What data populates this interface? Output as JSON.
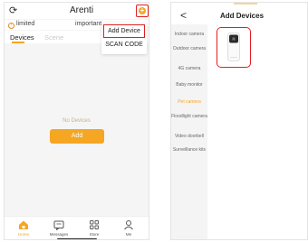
{
  "left_phone": {
    "header": {
      "title": "Arenti"
    },
    "top_tabs": {
      "limited": "limited",
      "important": "important"
    },
    "device_tabs": {
      "devices": "Devices",
      "scene": "Scene"
    },
    "dropdown": {
      "add_device": "Add Device",
      "scan_code": "SCAN CODE"
    },
    "empty_state": {
      "message": "No Devices",
      "add_button": "Add"
    },
    "tabbar": [
      {
        "label": "Home",
        "icon": "home-icon"
      },
      {
        "label": "Messages",
        "icon": "messages-icon"
      },
      {
        "label": "Store",
        "icon": "store-icon"
      },
      {
        "label": "Me",
        "icon": "me-icon"
      }
    ],
    "colors": {
      "accent": "#f5a623",
      "highlight": "#e02020"
    }
  },
  "right_phone": {
    "header": {
      "title": "Add Devices",
      "back_icon": "back-chevron-icon"
    },
    "categories": [
      {
        "label": "Indoor camera"
      },
      {
        "label": "Outdoor camera"
      },
      {
        "label": "4G camera"
      },
      {
        "label": "Baby monitor"
      },
      {
        "label": "Pet camera",
        "active": true
      },
      {
        "label": "Floodlight camera"
      },
      {
        "label": "Video doorbell"
      },
      {
        "label": "Surveillance kits"
      }
    ],
    "selected_product": {
      "icon": "pet-camera-icon"
    }
  }
}
